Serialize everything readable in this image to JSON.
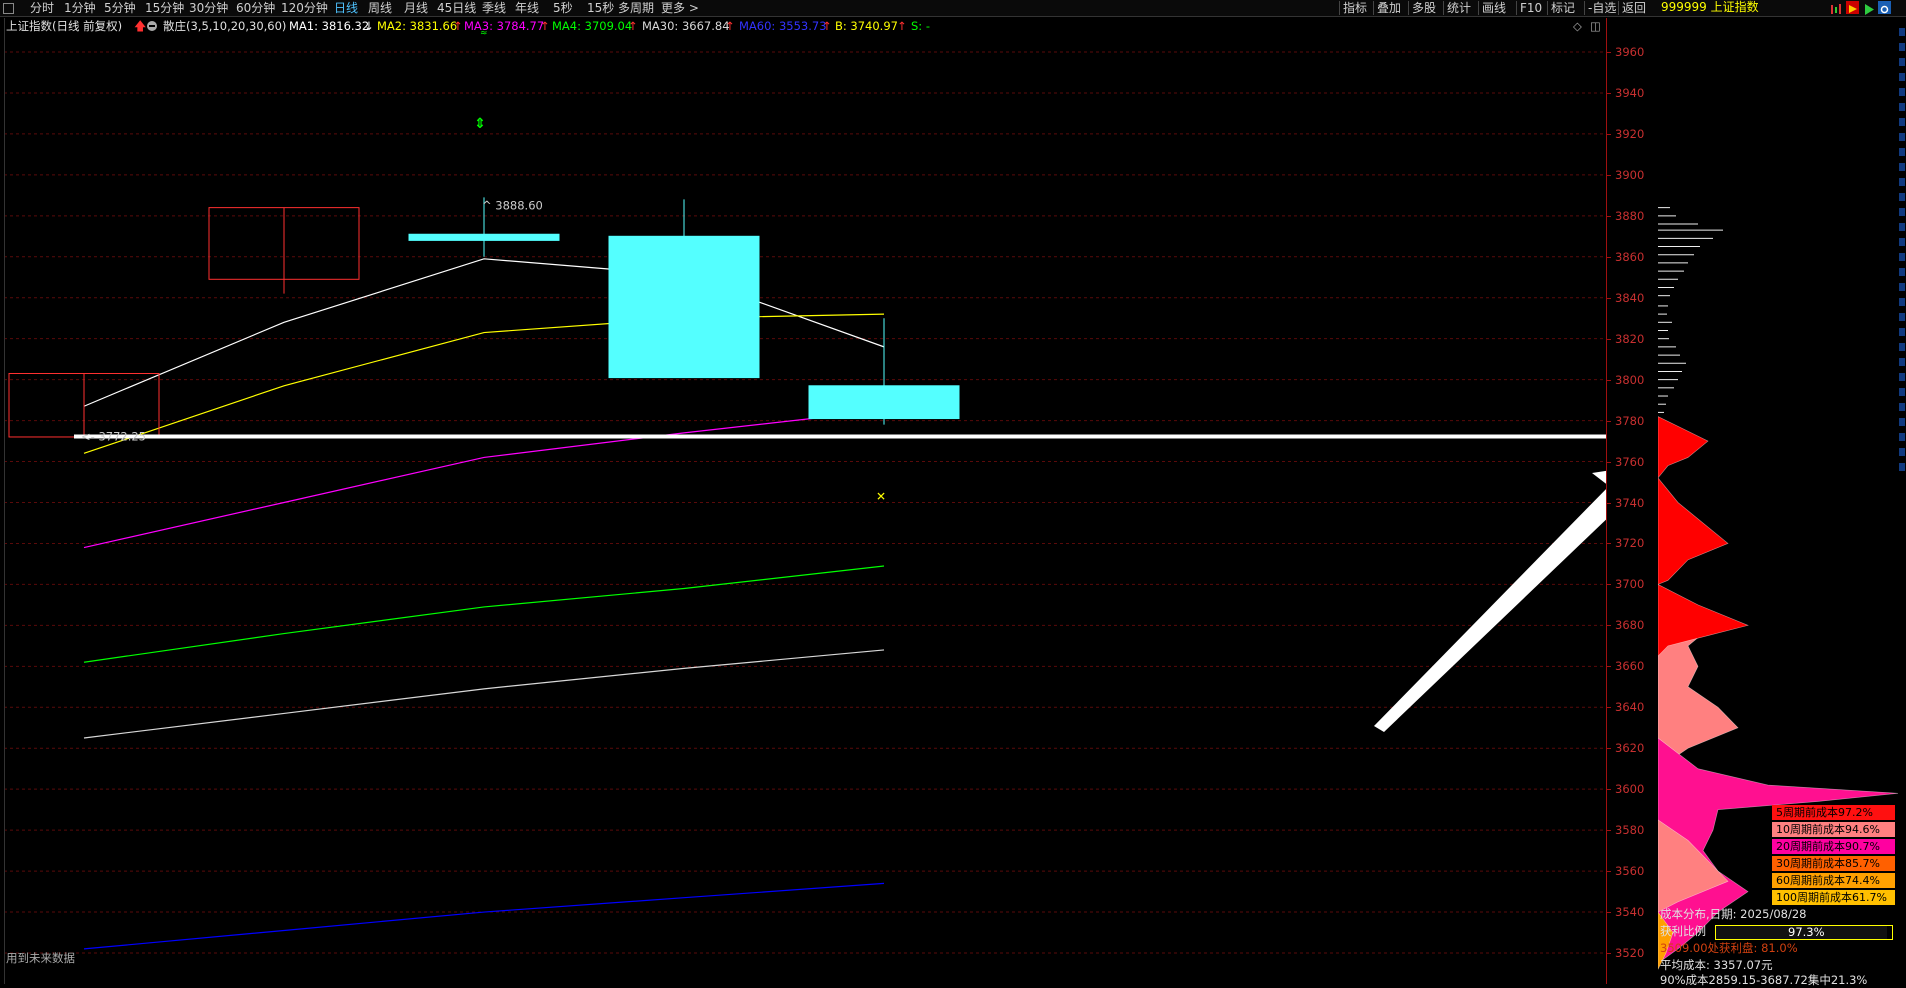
{
  "toolbar": {
    "periods": [
      "分时",
      "1分钟",
      "5分钟",
      "15分钟",
      "30分钟",
      "60分钟",
      "120分钟",
      "日线",
      "周线",
      "月线",
      "45日线",
      "季线",
      "年线",
      "5秒",
      "15秒",
      "多周期",
      "更多 >"
    ],
    "active_period": "日线",
    "right_buttons": [
      "指标",
      "叠加",
      "多股",
      "统计",
      "画线",
      "F10",
      "标记",
      "-自选",
      "返回"
    ],
    "symbol_title": "999999 上证指数"
  },
  "legend": {
    "title": "上证指数(日线 前复权)",
    "indicator": "散庄(3,5,10,20,30,60)",
    "ma1": "MA1: 3816.32",
    "ma2": "MA2: 3831.66",
    "ma3": "MA3: 3784.77",
    "ma4": "MA4: 3709.04",
    "ma30": "MA30: 3667.84",
    "ma60": "MA60: 3553.73",
    "b": "B: 3740.97",
    "s": "S: -",
    "colors": {
      "ma1": "#ffffff",
      "ma2": "#ffff00",
      "ma3": "#ff00ff",
      "ma4": "#00ff00",
      "ma30": "#d8d8d8",
      "ma60": "#0000ff",
      "b": "#ffff00",
      "s": "#00ff00"
    }
  },
  "chart_data": {
    "type": "candlestick",
    "y_range": [
      3510,
      3975
    ],
    "y_ticks": [
      3960,
      3940,
      3920,
      3900,
      3880,
      3860,
      3840,
      3820,
      3800,
      3780,
      3760,
      3740,
      3720,
      3700,
      3680,
      3660,
      3640,
      3620,
      3600,
      3580,
      3560,
      3540,
      3520
    ],
    "candles": [
      {
        "open": 3772,
        "close": 3803,
        "high": 3803,
        "low": 3772,
        "color": "#ff3030",
        "filled": false
      },
      {
        "open": 3849,
        "close": 3884,
        "high": 3884,
        "low": 3842,
        "color": "#ff3030",
        "filled": false
      },
      {
        "open": 3871,
        "close": 3868,
        "high": 3889,
        "low": 3860,
        "color": "#54ffff",
        "filled": true
      },
      {
        "open": 3870,
        "close": 3801,
        "high": 3888,
        "low": 3801,
        "color": "#54ffff",
        "filled": true
      },
      {
        "open": 3797,
        "close": 3781,
        "high": 3830,
        "low": 3778,
        "color": "#54ffff",
        "filled": true
      }
    ],
    "ma_lines": [
      {
        "name": "MA1",
        "color": "#ffffff",
        "values": [
          3787,
          3828,
          3859,
          3851,
          3816
        ]
      },
      {
        "name": "MA2",
        "color": "#ffff00",
        "values": [
          3764,
          3797,
          3823,
          3830,
          3832
        ]
      },
      {
        "name": "MA3",
        "color": "#ff00ff",
        "values": [
          3718,
          3740,
          3762,
          3774,
          3785
        ]
      },
      {
        "name": "MA4",
        "color": "#00ff00",
        "values": [
          3662,
          3676,
          3689,
          3698,
          3709
        ]
      },
      {
        "name": "MA30",
        "color": "#d8d8d8",
        "values": [
          3625,
          3637,
          3649,
          3659,
          3668
        ]
      },
      {
        "name": "MA60",
        "color": "#0000ff",
        "values": [
          3522,
          3531,
          3540,
          3547,
          3554
        ]
      }
    ],
    "annotations": {
      "high_label": "3888.60",
      "low_label": "3772.25",
      "horizontal_line": 3772.25
    }
  },
  "distribution": {
    "pct_rows": [
      {
        "label": "5周期前成本97.2%",
        "color": "#ff1010"
      },
      {
        "label": "10周期前成本94.6%",
        "color": "#ff8080"
      },
      {
        "label": "20周期前成本90.7%",
        "color": "#ff00a0"
      },
      {
        "label": "30周期前成本85.7%",
        "color": "#ff6000"
      },
      {
        "label": "60周期前成本74.4%",
        "color": "#ffa000"
      },
      {
        "label": "100周期前成本61.7%",
        "color": "#ffc000"
      }
    ],
    "info": {
      "date_line": "成本分布,日期: 2025/08/28",
      "profit_label": "获利比例",
      "profit_value": "97.3%",
      "line3": "3509.00处获利盘: 81.0%",
      "avg_cost": "平均成本: 3357.07元",
      "range90": "90%成本2859.15-3687.72集中21.3%"
    }
  },
  "bottom_note": "用到未来数据"
}
